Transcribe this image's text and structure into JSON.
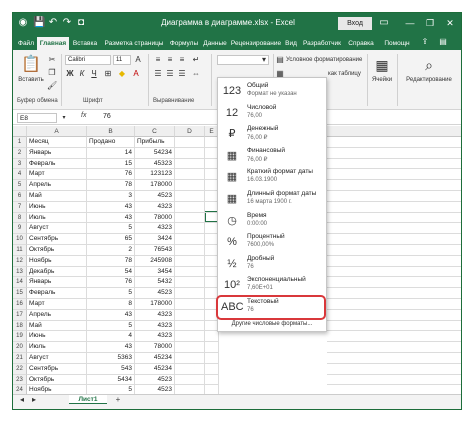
{
  "window": {
    "title": "Диаграмма в диаграмме.xlsx - Excel",
    "login_label": "Вход",
    "controls": [
      "—",
      "❐",
      "✕"
    ]
  },
  "tabs": [
    "Файл",
    "Главная",
    "Вставка",
    "Разметка страницы",
    "Формулы",
    "Данные",
    "Рецензирование",
    "Вид",
    "Разработчик",
    "Справка",
    "Помощн"
  ],
  "ribbon": {
    "paste_label": "Вставить",
    "clipboard_label": "Буфер обмена",
    "font_name": "Calibri",
    "font_size": "11",
    "font_group_label": "Шрифт",
    "align_group_label": "Выравнивание",
    "number_format_value": "",
    "cond_format_label": "Условное форматирование",
    "table_format_label": "как таблицу",
    "cells_label": "Ячейки",
    "editing_label": "Редактирование"
  },
  "formula_bar": {
    "name_box": "E8",
    "fx": "fx",
    "value": "76"
  },
  "grid": {
    "columns": [
      "A",
      "B",
      "C",
      "D",
      "E"
    ],
    "headers": [
      "Месяц",
      "Продано",
      "Прибыль"
    ],
    "rows": [
      {
        "n": "1",
        "month": "Месяц",
        "sold": "Продано",
        "profit": "Прибыль"
      },
      {
        "n": "2",
        "month": "Январь",
        "sold": "14",
        "profit": "54234"
      },
      {
        "n": "3",
        "month": "Февраль",
        "sold": "15",
        "profit": "45323"
      },
      {
        "n": "4",
        "month": "Март",
        "sold": "76",
        "profit": "123123"
      },
      {
        "n": "5",
        "month": "Апрель",
        "sold": "78",
        "profit": "178000"
      },
      {
        "n": "6",
        "month": "Май",
        "sold": "3",
        "profit": "4523"
      },
      {
        "n": "7",
        "month": "Июнь",
        "sold": "43",
        "profit": "4323"
      },
      {
        "n": "8",
        "month": "Июль",
        "sold": "43",
        "profit": "78000"
      },
      {
        "n": "9",
        "month": "Август",
        "sold": "5",
        "profit": "4323"
      },
      {
        "n": "10",
        "month": "Сентябрь",
        "sold": "65",
        "profit": "3424"
      },
      {
        "n": "11",
        "month": "Октябрь",
        "sold": "2",
        "profit": "76543"
      },
      {
        "n": "12",
        "month": "Ноябрь",
        "sold": "78",
        "profit": "245908"
      },
      {
        "n": "13",
        "month": "Декабрь",
        "sold": "54",
        "profit": "3454"
      },
      {
        "n": "14",
        "month": "Январь",
        "sold": "76",
        "profit": "5432"
      },
      {
        "n": "15",
        "month": "Февраль",
        "sold": "5",
        "profit": "4523"
      },
      {
        "n": "16",
        "month": "Март",
        "sold": "8",
        "profit": "178000"
      },
      {
        "n": "17",
        "month": "Апрель",
        "sold": "43",
        "profit": "4323"
      },
      {
        "n": "18",
        "month": "Май",
        "sold": "5",
        "profit": "4323"
      },
      {
        "n": "19",
        "month": "Июнь",
        "sold": "4",
        "profit": "4323"
      },
      {
        "n": "20",
        "month": "Июль",
        "sold": "43",
        "profit": "78000"
      },
      {
        "n": "21",
        "month": "Август",
        "sold": "5363",
        "profit": "45234"
      },
      {
        "n": "22",
        "month": "Сентябрь",
        "sold": "543",
        "profit": "45234"
      },
      {
        "n": "23",
        "month": "Октябрь",
        "sold": "5434",
        "profit": "4523"
      },
      {
        "n": "24",
        "month": "Ноябрь",
        "sold": "5",
        "profit": "4523"
      },
      {
        "n": "25",
        "month": "Декабрь",
        "sold": "43",
        "profit": "78000"
      }
    ]
  },
  "sheet_tab": "Лист1",
  "add_sheet": "+",
  "number_formats": [
    {
      "icon": "123",
      "name": "Общий",
      "example": "Формат не указан"
    },
    {
      "icon": "12",
      "name": "Числовой",
      "example": "76,00"
    },
    {
      "icon": "₽",
      "name": "Денежный",
      "example": "76,00 ₽"
    },
    {
      "icon": "▦",
      "name": "Финансовый",
      "example": "76,00 ₽"
    },
    {
      "icon": "▦",
      "name": "Краткий формат даты",
      "example": "16.03.1900"
    },
    {
      "icon": "▦",
      "name": "Длинный формат даты",
      "example": "16 марта 1900 г."
    },
    {
      "icon": "◷",
      "name": "Время",
      "example": "0:00:00"
    },
    {
      "icon": "%",
      "name": "Процентный",
      "example": "7600,00%"
    },
    {
      "icon": "½",
      "name": "Дробный",
      "example": "76"
    },
    {
      "icon": "10²",
      "name": "Экспоненциальный",
      "example": "7,60E+01"
    },
    {
      "icon": "ABC",
      "name": "Текстовый",
      "example": "76"
    }
  ],
  "more_formats": "Другие числовые форматы..."
}
